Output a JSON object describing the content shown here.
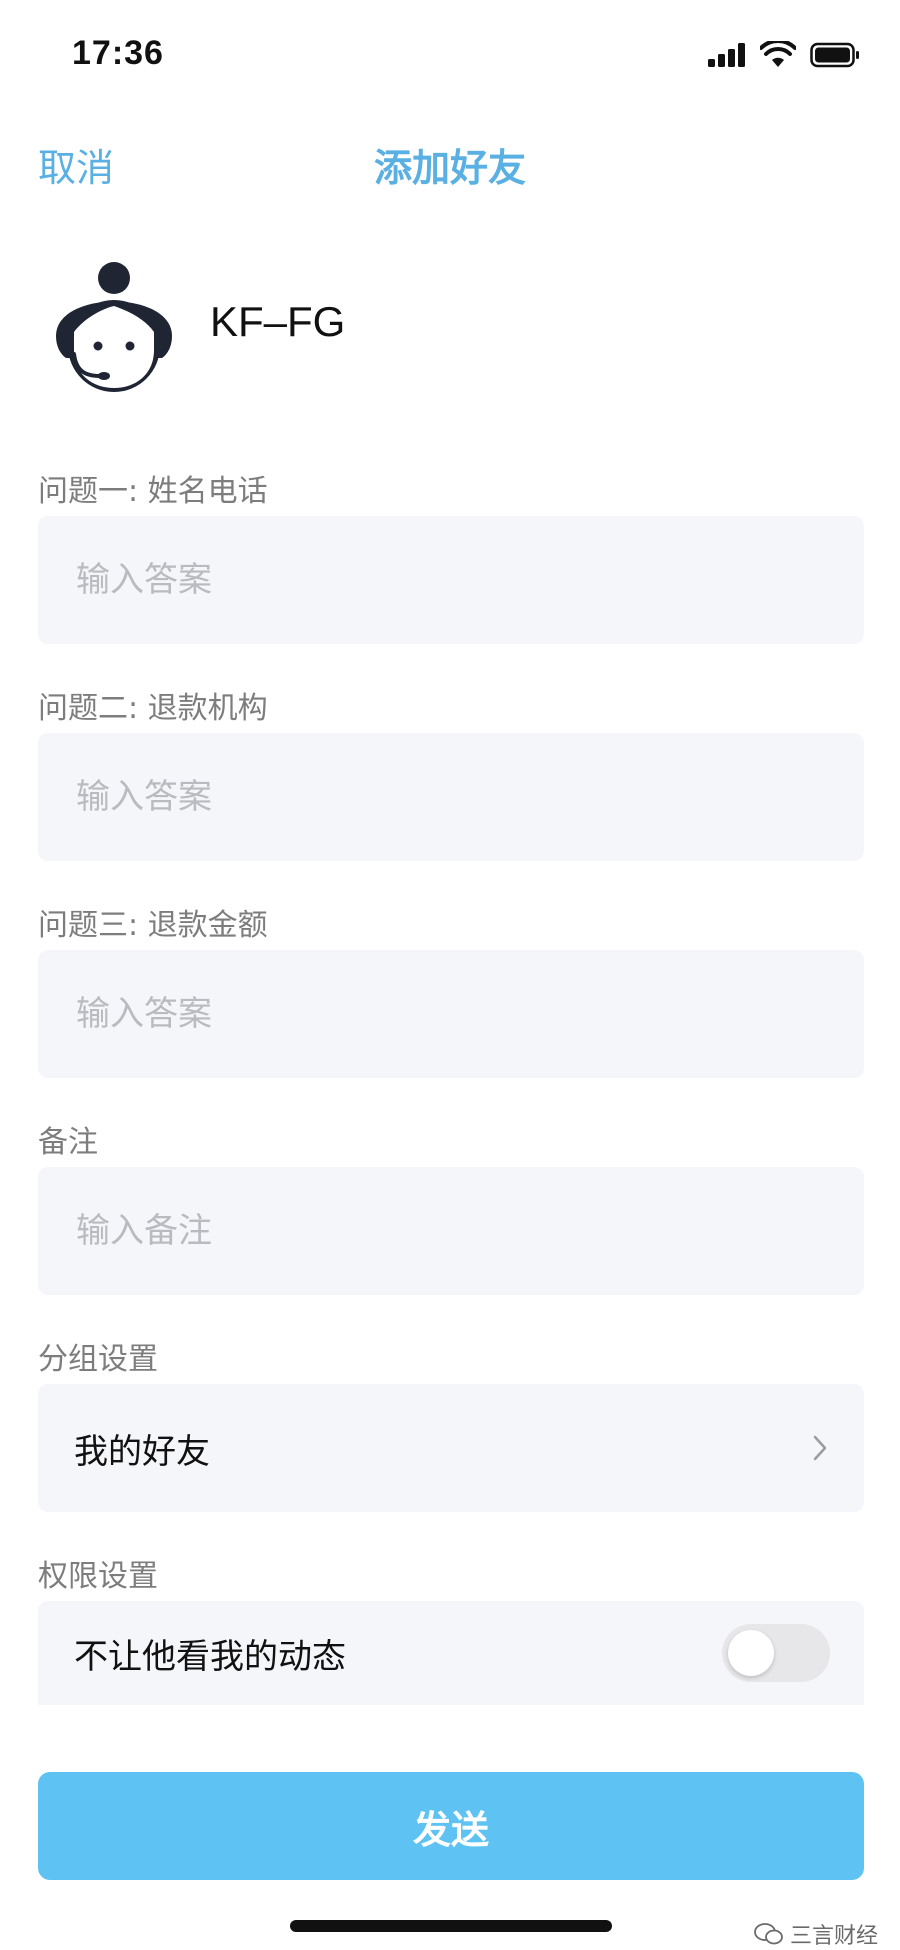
{
  "status_bar": {
    "time": "17:36"
  },
  "nav": {
    "cancel": "取消",
    "title": "添加好友"
  },
  "profile": {
    "name": "KF–FG"
  },
  "form": {
    "q1_label": "问题一: 姓名电话",
    "q1_placeholder": "输入答案",
    "q2_label": "问题二: 退款机构",
    "q2_placeholder": "输入答案",
    "q3_label": "问题三: 退款金额",
    "q3_placeholder": "输入答案",
    "remark_label": "备注",
    "remark_placeholder": "输入备注",
    "group_label": "分组设置",
    "group_value": "我的好友",
    "permission_label": "权限设置",
    "permission_option": "不让他看我的动态",
    "permission_enabled": false
  },
  "send_button": "发送",
  "watermark": "三言财经",
  "colors": {
    "accent": "#5ab0e3",
    "button": "#5ec3f3",
    "field_bg": "#f5f6f9"
  }
}
